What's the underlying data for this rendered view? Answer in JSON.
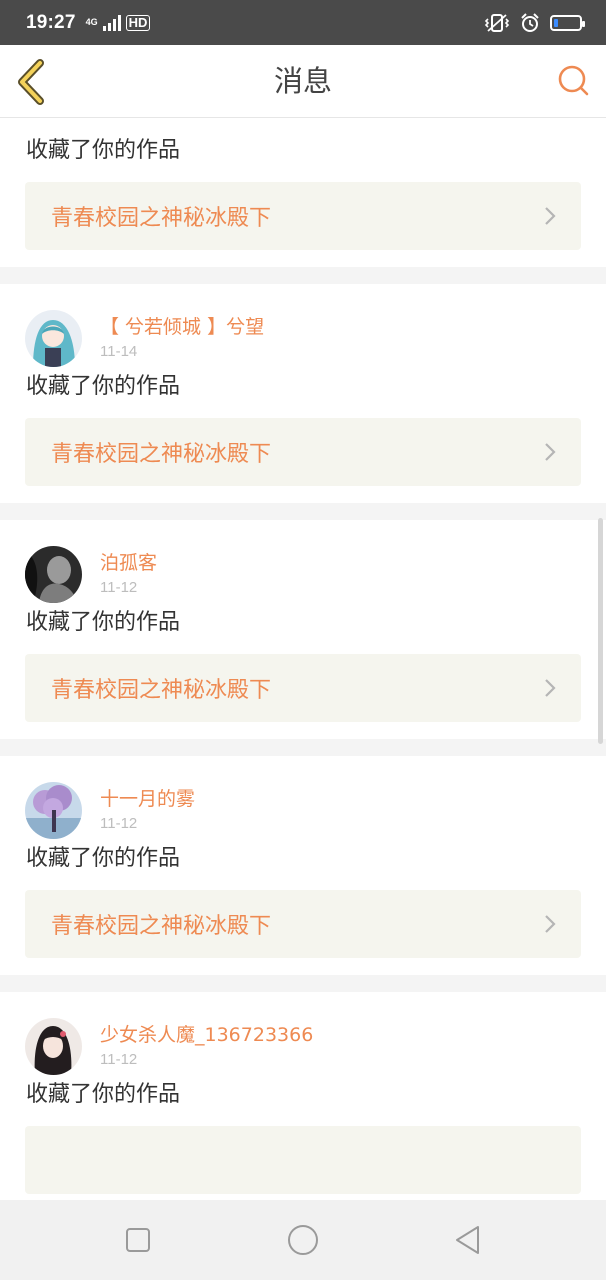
{
  "status_bar": {
    "time": "19:27",
    "network": "4G",
    "hd": "HD",
    "battery_level": 0.15
  },
  "header": {
    "title": "消息"
  },
  "partial_card": {
    "action": "收藏了你的作品",
    "work_title": "青春校园之神秘冰殿下"
  },
  "messages": [
    {
      "username": "【 兮若倾城 】兮望",
      "date": "11-14",
      "action": "收藏了你的作品",
      "work_title": "青春校园之神秘冰殿下",
      "avatar_icon": "anime-girl-avatar"
    },
    {
      "username": "泊孤客",
      "date": "11-12",
      "action": "收藏了你的作品",
      "work_title": "青春校园之神秘冰殿下",
      "avatar_icon": "monochrome-portrait-avatar"
    },
    {
      "username": "十一月的雾",
      "date": "11-12",
      "action": "收藏了你的作品",
      "work_title": "青春校园之神秘冰殿下",
      "avatar_icon": "purple-tree-avatar"
    },
    {
      "username": "少女杀人魔_136723366",
      "date": "11-12",
      "action": "收藏了你的作品",
      "work_title": "",
      "avatar_icon": "girl-portrait-avatar"
    }
  ],
  "colors": {
    "accent": "#ee8a52",
    "status_bar": "#4a4a4a",
    "work_box": "#f5f5ee"
  },
  "icons": [
    "back-chevron-icon",
    "search-icon",
    "chevron-right-icon",
    "square-icon",
    "circle-icon",
    "triangle-back-icon"
  ]
}
